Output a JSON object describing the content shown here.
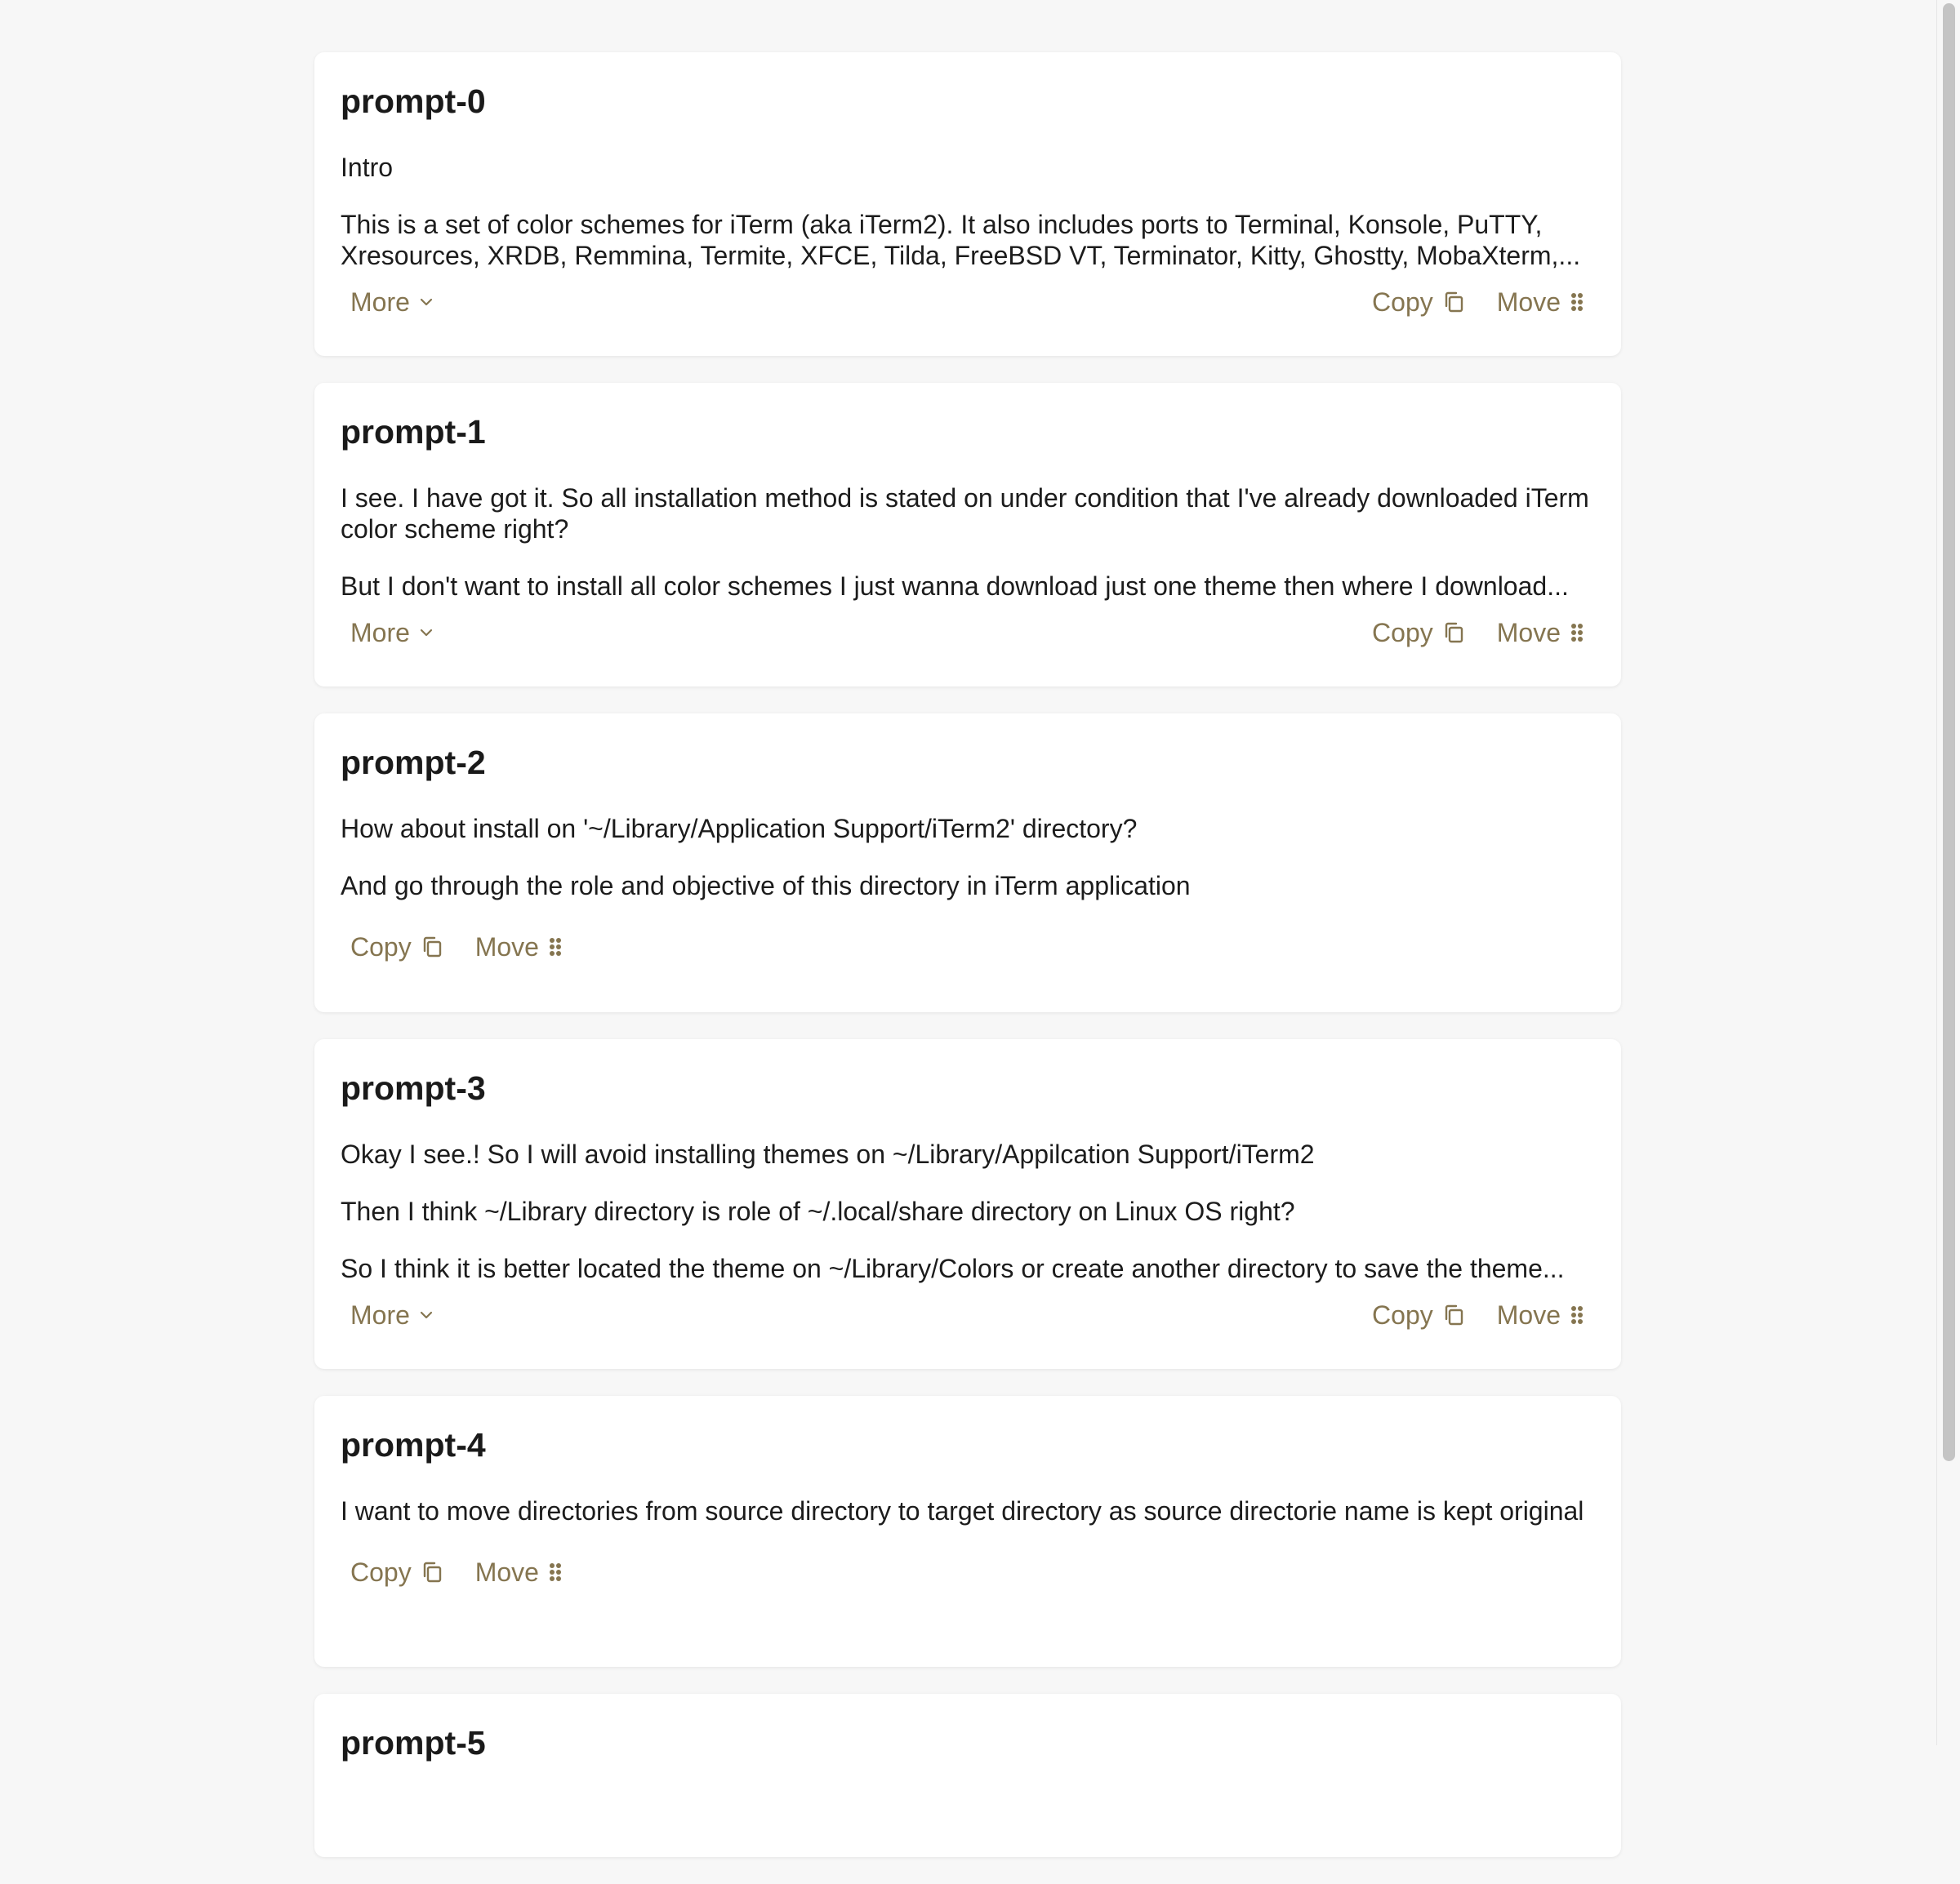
{
  "actions": {
    "more_label": "More",
    "copy_label": "Copy",
    "move_label": "Move"
  },
  "cards": [
    {
      "title": "prompt-0",
      "paragraphs": [
        "Intro",
        "This is a set of color schemes for iTerm (aka iTerm2). It also includes ports to Terminal, Konsole, PuTTY, Xresources, XRDB, Remmina, Termite, XFCE, Tilda, FreeBSD VT, Terminator, Kitty, Ghostty, MobaXterm,..."
      ]
    },
    {
      "title": "prompt-1",
      "paragraphs": [
        "I see. I have got it. So all installation method is stated on under condition that I've already downloaded iTerm color scheme right?",
        "But I don't want to install all color schemes I just wanna download just one theme then where I download..."
      ]
    },
    {
      "title": "prompt-2",
      "paragraphs": [
        "How about install on '~/Library/Application Support/iTerm2' directory?",
        "And go through the role and objective of this directory in iTerm application"
      ]
    },
    {
      "title": "prompt-3",
      "paragraphs": [
        "Okay I see.! So I will avoid installing themes on ~/Library/Appilcation Support/iTerm2",
        "Then I think ~/Library directory is role of ~/.local/share directory on Linux OS right?",
        "So I think it is better located the theme on ~/Library/Colors or create another directory to save the theme..."
      ]
    },
    {
      "title": "prompt-4",
      "paragraphs": [
        "I want to move directories from source directory to target directory as source directorie name is kept original"
      ]
    },
    {
      "title": "prompt-5",
      "paragraphs": []
    }
  ],
  "icons": {
    "more": "chevron-down-icon",
    "copy": "copy-icon",
    "move": "drag-handle-icon"
  },
  "colors": {
    "background": "#f7f7f7",
    "card": "#ffffff",
    "accent": "#857550",
    "text": "#1c1c1c"
  }
}
